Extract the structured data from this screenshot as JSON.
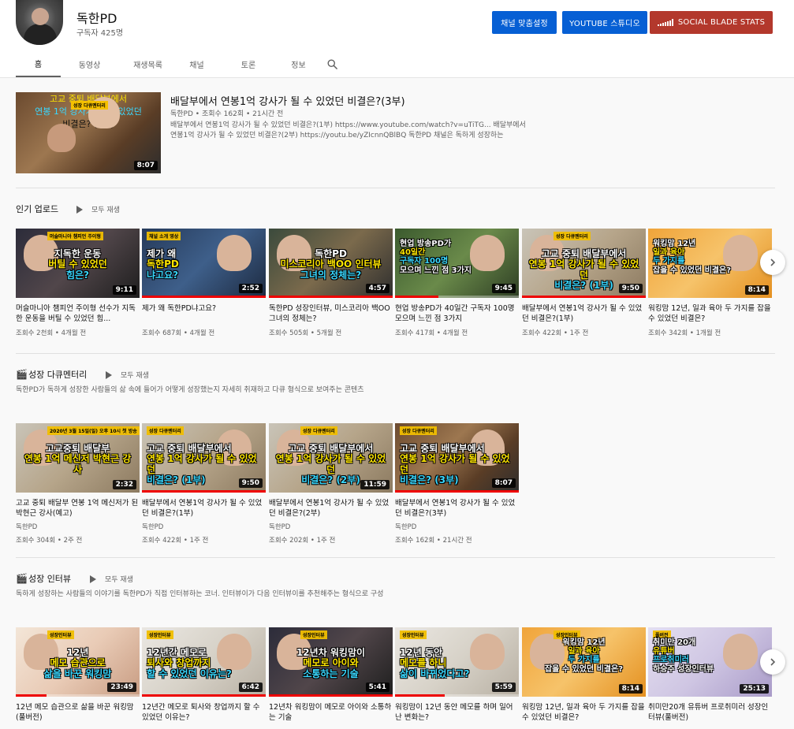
{
  "channel": {
    "name": "독한PD",
    "subscribers": "구독자 425명",
    "buttons": {
      "customize": "채널 맞춤설정",
      "studio": "YOUTUBE 스튜디오",
      "social_blade": "SOCIAL BLADE STATS"
    },
    "tabs": [
      "홈",
      "동영상",
      "재생목록",
      "채널",
      "토론",
      "정보"
    ],
    "active_tab": "홈"
  },
  "featured": {
    "title": "배달부에서 연봉1억 강사가 될 수 있었던 비결은?(3부)",
    "meta": "독한PD • 조회수 162회 • 21시간 전",
    "description": "배달부에서 연봉1억 강사가 될 수 있었던 비결은?(1부) https://www.youtube.com/watch?v=uTiTG... 배달부에서 연봉1억 강사가 될 수 있었던 비결은?(2부) https://youtu.be/yZIcnnQBlBQ 독한PD 채널은 독하게 성장하는",
    "thumb": {
      "badge": "성장 다큐멘터리",
      "lines": [
        "고교 중퇴 배달부에서",
        "연봉 1억 강사가 될 수 있었던",
        "비결은? (3부)"
      ],
      "duration": "8:07"
    }
  },
  "sections": [
    {
      "title": "인기 업로드",
      "icon": "",
      "play_all": "모두 재생",
      "description": "",
      "videos": [
        {
          "title": "머슬마니아 챔피언 주이형 선수가 지독한 운동을 버틸 수 있었던 힘...",
          "channel": "",
          "meta": "조회수 2천회 • 4개월 전",
          "duration": "9:11",
          "caption": [
            "지독한 운동",
            "버틸 수 있었던",
            "힘은?"
          ],
          "subcap": "머슬마니아 챔피언 주이형",
          "bg": "bg-dark",
          "progress": 0
        },
        {
          "title": "제가 왜 독한PD냐고요?",
          "channel": "",
          "meta": "조회수 687회 • 4개월 전",
          "duration": "2:52",
          "caption": [
            "제가 왜",
            "독한PD",
            "냐고요?"
          ],
          "subcap": "채널 소개 영상",
          "bg": "bg-blue",
          "progress": 100
        },
        {
          "title": "독한PD 성장인터뷰, 미스코리아 백OO 그녀의 정체는?",
          "channel": "",
          "meta": "조회수 505회 • 5개월 전",
          "duration": "4:57",
          "caption": [
            "독한PD",
            "미스코리아 백OO 인터뷰",
            "그녀의 정체는?"
          ],
          "subcap": "",
          "bg": "bg-room",
          "progress": 100
        },
        {
          "title": "현업 방송PD가 40일간 구독자 100명 모으며 느낀 점 3가지",
          "channel": "",
          "meta": "조회수 417회 • 4개월 전",
          "duration": "9:45",
          "caption": [
            "현업 방송PD가",
            "40일간",
            "구독자 100명",
            "모으며 느낀 점 3가지"
          ],
          "subcap": "",
          "bg": "bg-green",
          "progress": 35
        },
        {
          "title": "배달부에서 연봉1억 강사가 될 수 있었던 비결은?(1부)",
          "channel": "",
          "meta": "조회수 422회 • 1주 전",
          "duration": "9:50",
          "caption": [
            "고교 중퇴 배달부에서",
            "연봉 1억 강사가 될 수 있었던",
            "비결은? (1부)"
          ],
          "subcap": "성장 다큐멘터리",
          "bg": "bg-office",
          "progress": 100
        },
        {
          "title": "워킹맘 12년, 일과 육아 두 가지를 잡을 수 있었던 비결은?",
          "channel": "",
          "meta": "조회수 342회 • 1개월 전",
          "duration": "8:14",
          "caption": [
            "워킹맘 12년",
            "일과 육아",
            "두 가지를",
            "잡을 수 있었던 비결은?"
          ],
          "subcap": "",
          "bg": "bg-orange",
          "progress": 0
        }
      ]
    },
    {
      "title": "성장 다큐멘터리",
      "icon": "🎬",
      "play_all": "모두 재생",
      "description": "독한PD가 독하게 성장한 사람들의 삶 속에 들어가 어떻게 성장했는지 자세히 취재하고 다큐 형식으로 보여주는 콘텐츠",
      "videos": [
        {
          "title": "고교 중퇴 배달부 연봉 1억 메신저가 된 박현근 강사(예고)",
          "channel": "독한PD",
          "meta": "조회수 304회 • 2주 전",
          "duration": "2:32",
          "caption": [
            "고교중퇴 배달부",
            "연봉 1억 메신저 박현근 강사"
          ],
          "subcap": "2020년 3월 15일(일) 오후 10시 첫 방송",
          "bg": "bg-office",
          "progress": 0
        },
        {
          "title": "배달부에서 연봉1억 강사가 될 수 있었던 비결은?(1부)",
          "channel": "독한PD",
          "meta": "조회수 422회 • 1주 전",
          "duration": "9:50",
          "caption": [
            "고교 중퇴 배달부에서",
            "연봉 1억 강사가 될 수 있었던",
            "비결은? (1부)"
          ],
          "subcap": "성장 다큐멘터리",
          "bg": "bg-office",
          "progress": 100
        },
        {
          "title": "배달부에서 연봉1억 강사가 될 수 있었던 비결은?(2부)",
          "channel": "독한PD",
          "meta": "조회수 202회 • 1주 전",
          "duration": "11:59",
          "caption": [
            "고교 중퇴 배달부에서",
            "연봉 1억 강사가 될 수 있었던",
            "비결은? (2부)"
          ],
          "subcap": "성장 다큐멘터리",
          "bg": "bg-office",
          "progress": 0
        },
        {
          "title": "배달부에서 연봉1억 강사가 될 수 있었던 비결은?(3부)",
          "channel": "독한PD",
          "meta": "조회수 162회 • 21시간 전",
          "duration": "8:07",
          "caption": [
            "고교 중퇴 배달부에서",
            "연봉 1억 강사가 될 수 있었던",
            "비결은? (3부)"
          ],
          "subcap": "성장 다큐멘터리",
          "bg": "bg-wood",
          "progress": 100
        }
      ]
    },
    {
      "title": "성장 인터뷰",
      "icon": "🎬",
      "play_all": "모두 재생",
      "description": "독하게 성장하는 사람들의 이야기를 독한PD가 직접 인터뷰하는 코너. 인터뷰이가 다음 인터뷰이를 추천해주는 형식으로 구성",
      "videos": [
        {
          "title": "12년 메모 습관으로 삶을 바꾼 워킹맘 (풀버전)",
          "channel": "",
          "meta": "",
          "duration": "23:49",
          "caption": [
            "12년",
            "메모 습관으로",
            "삶을 바꾼 워킹맘"
          ],
          "subcap": "성장인터뷰",
          "bg": "bg-pink",
          "progress": 25
        },
        {
          "title": "12년간 메모로 퇴사와 창업까지 할 수 있었던 이유는?",
          "channel": "",
          "meta": "",
          "duration": "6:42",
          "caption": [
            "12년간 메모로",
            "퇴사와 창업까지",
            "할 수 있었던 이유는?"
          ],
          "subcap": "성장인터뷰",
          "bg": "bg-light",
          "progress": 100
        },
        {
          "title": "12년차 워킹맘이 메모로 아이와 소통하는 기술",
          "channel": "",
          "meta": "",
          "duration": "5:41",
          "caption": [
            "12년차 워킹맘이",
            "메모로 아이와",
            "소통하는 기술"
          ],
          "subcap": "성장인터뷰",
          "bg": "bg-dark",
          "progress": 100
        },
        {
          "title": "워킹맘이 12년 동안 메모를 하며 일어난 변화는?",
          "channel": "",
          "meta": "",
          "duration": "5:59",
          "caption": [
            "12년 동안",
            "메모를 하니",
            "삶이 바뀌었다고?"
          ],
          "subcap": "성장인터뷰",
          "bg": "bg-light",
          "progress": 40
        },
        {
          "title": "워킹맘 12년, 일과 육아 두 가지를 잡을 수 있었던 비결은?",
          "channel": "",
          "meta": "",
          "duration": "8:14",
          "caption": [
            "워킹맘 12년",
            "일과 육아",
            "두 가지를",
            "잡을 수 있었던 비결은?"
          ],
          "subcap": "성장인터뷰",
          "bg": "bg-orange",
          "progress": 0
        },
        {
          "title": "취미만20개 유튜버 프로취미러 성장인터뷰(풀버전)",
          "channel": "",
          "meta": "",
          "duration": "25:13",
          "caption": [
            "취미만 20개",
            "유튜버",
            "프로취미러",
            "하승주 성장인터뷰"
          ],
          "subcap": "풀버전",
          "bg": "bg-purple",
          "progress": 0
        }
      ]
    }
  ],
  "colors": {
    "accent_blue": "#065fd4",
    "social_blade_red": "#b3382c",
    "progress_red": "#ee0000",
    "caption_yellow": "#ffe600",
    "caption_cyan": "#39d8ff"
  },
  "icons": {
    "search": "search-icon",
    "play_all": "play-icon",
    "next": "chevron-right-icon",
    "section": "clapperboard-icon"
  }
}
